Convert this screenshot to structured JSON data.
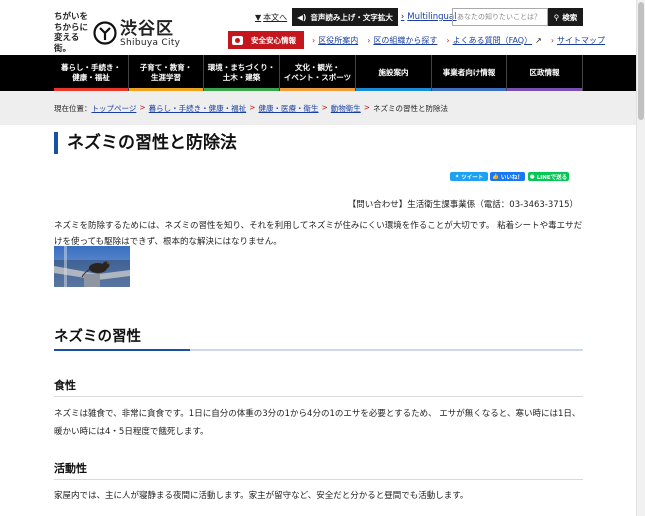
{
  "header": {
    "logo": {
      "tagline": [
        "ちがいを",
        "ちからに",
        "変える街。"
      ],
      "name": "渋谷区",
      "name_roman": "Shibuya City"
    },
    "skip_link": "本文へ",
    "voice_button": "音声読み上げ・文字拡大",
    "multilingual": "Multilingual",
    "search": {
      "placeholder": "あなたの知りたいことは？",
      "button": "検索"
    },
    "safety_button": "安全安心情報",
    "links": [
      "区役所案内",
      "区の組織から探す",
      "よくある質問（FAQ）",
      "サイトマップ"
    ]
  },
  "nav": [
    {
      "label": "暮らし・手続き・\n健康・福祉",
      "color": "#e8362a"
    },
    {
      "label": "子育て・教育・\n生涯学習",
      "color": "#f0a21f"
    },
    {
      "label": "環境・まちづくり・\n土木・建築",
      "color": "#3aa54a"
    },
    {
      "label": "文化・観光・\nイベント・スポーツ",
      "color": "#f19a3c"
    },
    {
      "label": "施設案内",
      "color": "#1a8bd8"
    },
    {
      "label": "事業者向け情報",
      "color": "#3c6fc4"
    },
    {
      "label": "区政情報",
      "color": "#7a4fb3"
    }
  ],
  "breadcrumb": {
    "prefix": "現在位置：",
    "items": [
      "トップページ",
      "暮らし・手続き・健康・福祉",
      "健康・医療・衛生",
      "動物衛生"
    ],
    "current": "ネズミの習性と防除法"
  },
  "page": {
    "title": "ネズミの習性と防除法",
    "share": {
      "tweet": "ツイート",
      "like": "いいね！",
      "line": "LINEで送る"
    },
    "inquiry": "【問い合わせ】生活衛生課事業係（電話：03-3463-3715）",
    "lead": "ネズミを防除するためには、ネズミの習性を知り、それを利用してネズミが住みにくい環境を作ることが大切です。 粘着シートや毒エサだけを使っても駆除はできず、根本的な解決にはなりません。",
    "section_title": "ネズミの習性",
    "subsections": [
      {
        "title": "食性",
        "text": "ネズミは雑食で、非常に貪食です。1日に自分の体重の3分の1から4分の1のエサを必要とするため、 エサが無くなると、寒い時には1日、暖かい時には4・5日程度で餓死します。"
      },
      {
        "title": "活動性",
        "text": "家屋内では、主に人が寝静まる夜間に活動します。家主が留守など、安全だと分かると昼間でも活動します。"
      }
    ]
  },
  "colors": {
    "accent_blue": "#1a4fa8",
    "safety_red": "#c4161c",
    "twitter": "#1da1f2",
    "facebook": "#1877f2",
    "line": "#06c755"
  }
}
